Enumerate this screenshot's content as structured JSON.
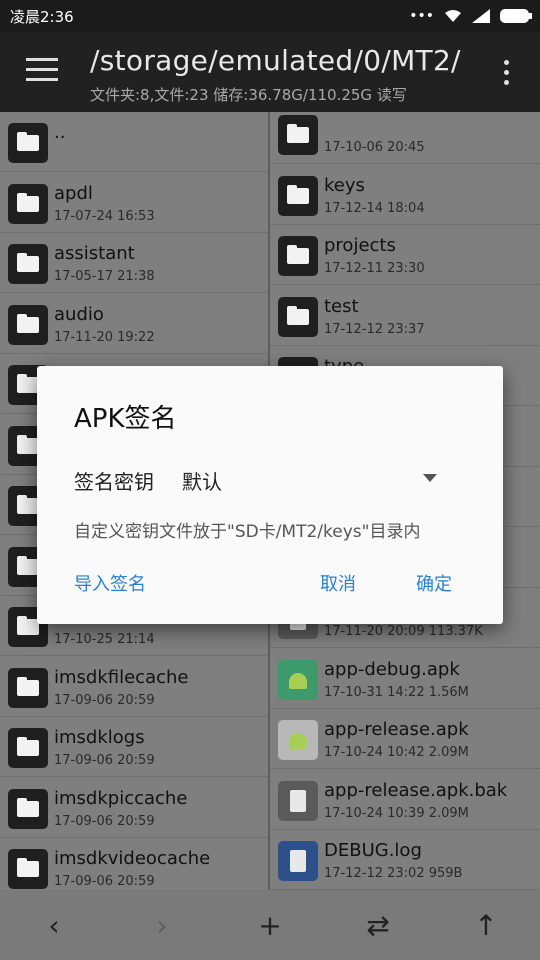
{
  "status": {
    "time": "凌晨2:36"
  },
  "header": {
    "path": "/storage/emulated/0/MT2/",
    "info": "文件夹:8,文件:23  储存:36.78G/110.25G  读写"
  },
  "left_pane": [
    {
      "name": "..",
      "date": ""
    },
    {
      "name": "apdl",
      "date": "17-07-24 16:53"
    },
    {
      "name": "assistant",
      "date": "17-05-17 21:38"
    },
    {
      "name": "audio",
      "date": "17-11-20 19:22"
    },
    {
      "name": "",
      "date": ""
    },
    {
      "name": "",
      "date": ""
    },
    {
      "name": "",
      "date": ""
    },
    {
      "name": "",
      "date": ""
    },
    {
      "name": "",
      "date": "17-10-25 21:14"
    },
    {
      "name": "imsdkfilecache",
      "date": "17-09-06 20:59"
    },
    {
      "name": "imsdklogs",
      "date": "17-09-06 20:59"
    },
    {
      "name": "imsdkpiccache",
      "date": "17-09-06 20:59"
    },
    {
      "name": "imsdkvideocache",
      "date": "17-09-06 20:59"
    }
  ],
  "right_pane": [
    {
      "name": "",
      "date": "17-10-06 20:45",
      "icon": "folder"
    },
    {
      "name": "keys",
      "date": "17-12-14 18:04",
      "icon": "folder"
    },
    {
      "name": "projects",
      "date": "17-12-11 23:30",
      "icon": "folder"
    },
    {
      "name": "test",
      "date": "17-12-12 23:37",
      "icon": "folder"
    },
    {
      "name": "type",
      "date": "",
      "icon": "folder"
    },
    {
      "name": "",
      "date": "",
      "icon": "folder"
    },
    {
      "name": "",
      "date": "",
      "icon": "folder"
    },
    {
      "name": "",
      "date": "",
      "icon": "folder"
    },
    {
      "name": "",
      "date": "17-11-20 20:09  113.37K",
      "icon": "file"
    },
    {
      "name": "app-debug.apk",
      "date": "17-10-31 14:22  1.56M",
      "icon": "apk"
    },
    {
      "name": "app-release.apk",
      "date": "17-10-24 10:42  2.09M",
      "icon": "apk2"
    },
    {
      "name": "app-release.apk.bak",
      "date": "17-10-24 10:39  2.09M",
      "icon": "file"
    },
    {
      "name": "DEBUG.log",
      "date": "17-12-12 23:02  959B",
      "icon": "log"
    }
  ],
  "dialog": {
    "title": "APK签名",
    "label": "签名密钥",
    "selected": "默认",
    "hint": "自定义密钥文件放于\"SD卡/MT2/keys\"目录内",
    "import": "导入签名",
    "cancel": "取消",
    "ok": "确定"
  },
  "bottom": {
    "back": "‹",
    "forward": "›",
    "add": "+",
    "swap": "⇄",
    "up": "↑"
  }
}
